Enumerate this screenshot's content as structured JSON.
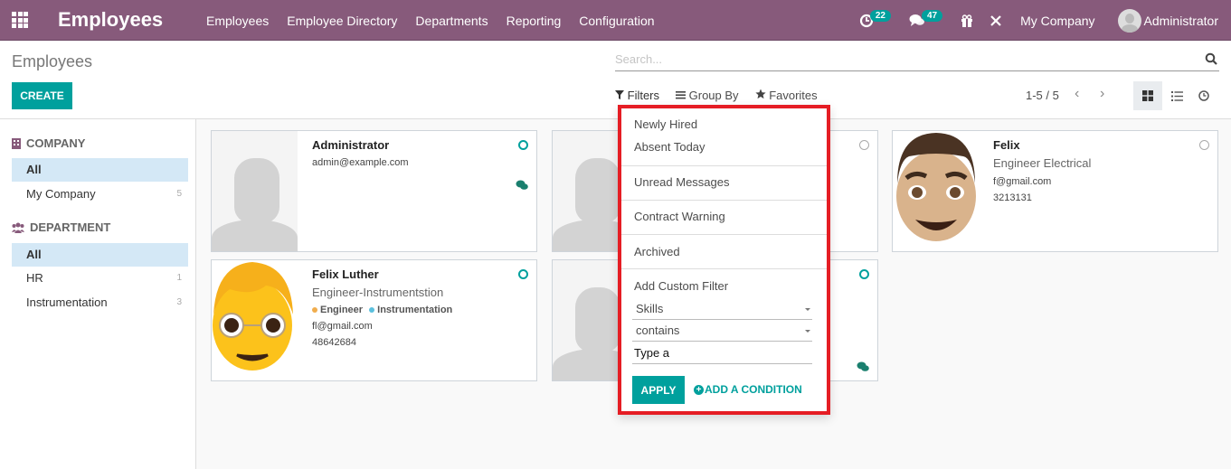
{
  "navbar": {
    "app_title": "Employees",
    "menu": [
      "Employees",
      "Employee Directory",
      "Departments",
      "Reporting",
      "Configuration"
    ],
    "activity_count": "22",
    "messages_count": "47",
    "company": "My Company",
    "user": "Administrator",
    "bg_color": "#875a7b"
  },
  "control": {
    "breadcrumb": "Employees",
    "create_label": "CREATE",
    "search_placeholder": "Search...",
    "filters_label": "Filters",
    "groupby_label": "Group By",
    "favorites_label": "Favorites",
    "pager": "1-5 / 5"
  },
  "sidebar": {
    "company_header": "COMPANY",
    "company_items": [
      {
        "label": "All",
        "count": ""
      },
      {
        "label": "My Company",
        "count": "5"
      }
    ],
    "department_header": "DEPARTMENT",
    "department_items": [
      {
        "label": "All",
        "count": ""
      },
      {
        "label": "HR",
        "count": "1"
      },
      {
        "label": "Instrumentation",
        "count": "3"
      }
    ]
  },
  "employees": [
    {
      "name": "Administrator",
      "job": "",
      "tags": [],
      "email": "admin@example.com",
      "phone": "",
      "status": "online",
      "photo": "placeholder",
      "has_messages": true
    },
    {
      "name": "Felix Luther",
      "job": "Engineer-Instrumentstion",
      "tags": [
        {
          "label": "Engineer",
          "color": "#f0ad4e"
        },
        {
          "label": "Instrumentation",
          "color": "#5bc0de"
        }
      ],
      "email": "fl@gmail.com",
      "phone": "48642684",
      "status": "online",
      "photo": "emoji-glasses",
      "has_messages": false
    },
    {
      "name": "",
      "job": "",
      "tags": [],
      "email": "",
      "phone": "",
      "status": "offline",
      "photo": "placeholder",
      "has_messages": false
    },
    {
      "name": "",
      "job": "",
      "tags": [],
      "email": "",
      "phone": "",
      "status": "online",
      "photo": "placeholder",
      "has_messages": true
    },
    {
      "name": "Felix",
      "job": "Engineer Electrical",
      "tags": [],
      "email": "f@gmail.com",
      "phone": "3213131",
      "status": "offline",
      "photo": "emoji-man",
      "has_messages": false
    }
  ],
  "filter_dropdown": {
    "items": [
      "Newly Hired",
      "Absent Today",
      "Unread Messages",
      "Contract Warning",
      "Archived"
    ],
    "custom_filter_label": "Add Custom Filter",
    "field_value": "Skills",
    "operator_value": "contains",
    "value_input": "Type a",
    "apply_label": "APPLY",
    "add_condition_label": "ADD A CONDITION"
  },
  "colors": {
    "accent": "#00a09d",
    "highlight_border": "#e51d24",
    "sidebar_active": "#d4e8f6"
  }
}
